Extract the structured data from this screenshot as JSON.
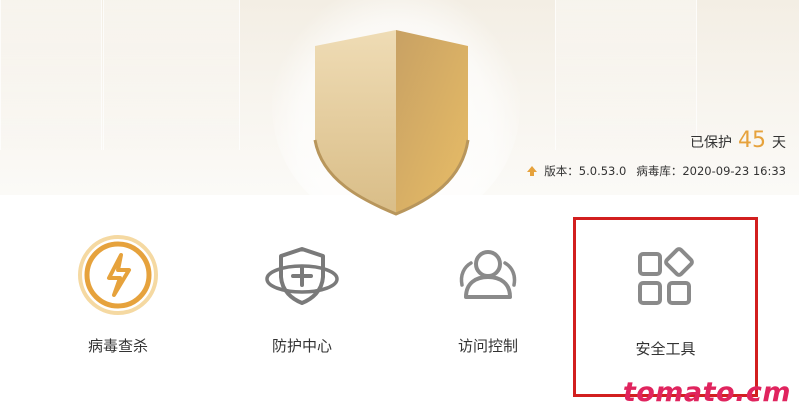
{
  "status": {
    "protected_prefix": "已保护",
    "protected_days": "45",
    "protected_suffix": "天",
    "version_label": "版本：",
    "version_value": "5.0.53.0",
    "virus_db_label": "病毒库：",
    "virus_db_value": "2020-09-23 16:33"
  },
  "nav": {
    "items": [
      {
        "label": "病毒查杀",
        "icon": "lightning-circle-icon"
      },
      {
        "label": "防护中心",
        "icon": "shield-plus-icon"
      },
      {
        "label": "访问控制",
        "icon": "users-icon"
      },
      {
        "label": "安全工具",
        "icon": "apps-grid-icon"
      }
    ]
  },
  "watermark": "tomato.cm",
  "colors": {
    "accent": "#e6a23c",
    "shield_light": "#ead7ad",
    "shield_dark": "#c79f5a",
    "selection_border": "#d21f1f",
    "watermark": "#e0245e",
    "icon_gray": "#8a8a8a"
  }
}
